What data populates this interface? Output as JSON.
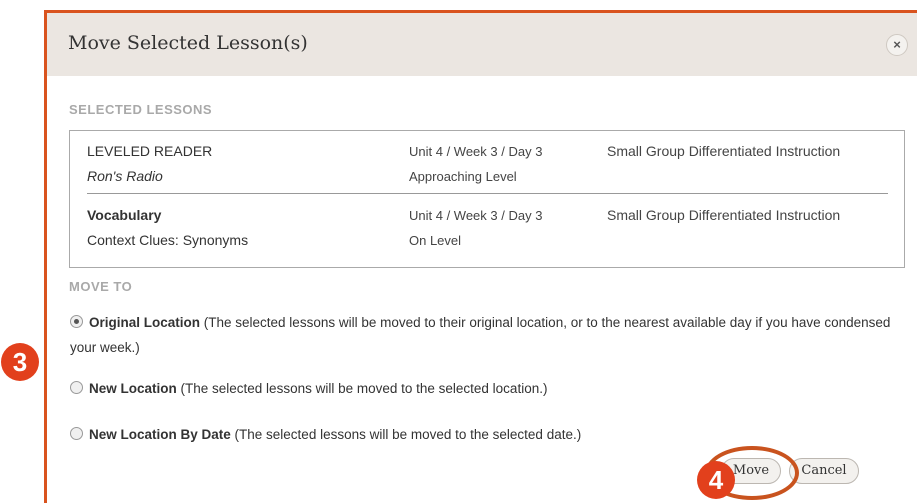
{
  "dialog": {
    "title": "Move Selected Lesson(s)",
    "close_label": "×"
  },
  "selected_lessons": {
    "label": "SELECTED LESSONS",
    "rows": [
      {
        "name": "LEVELED READER",
        "subtitle": "Ron's Radio",
        "unit": "Unit 4 / Week 3 / Day 3",
        "level": "Approaching Level",
        "type": "Small Group Differentiated Instruction"
      },
      {
        "name": "Vocabulary",
        "subtitle": "Context Clues: Synonyms",
        "unit": "Unit 4 / Week 3 / Day 3",
        "level": "On Level",
        "type": "Small Group Differentiated Instruction"
      }
    ]
  },
  "move_to": {
    "label": "MOVE TO",
    "options": [
      {
        "title": "Original Location",
        "description": " (The selected lessons will be moved to their original location, or to the nearest available day if you have condensed your week.)",
        "checked": true
      },
      {
        "title": "New Location",
        "description": " (The selected lessons will be moved to the selected location.)",
        "checked": false
      },
      {
        "title": "New Location By Date",
        "description": " (The selected lessons will be moved to the selected date.)",
        "checked": false
      }
    ]
  },
  "buttons": {
    "move": "Move",
    "cancel": "Cancel"
  },
  "annotations": {
    "step3": "3",
    "step4": "4",
    "color": "#e2401c"
  }
}
